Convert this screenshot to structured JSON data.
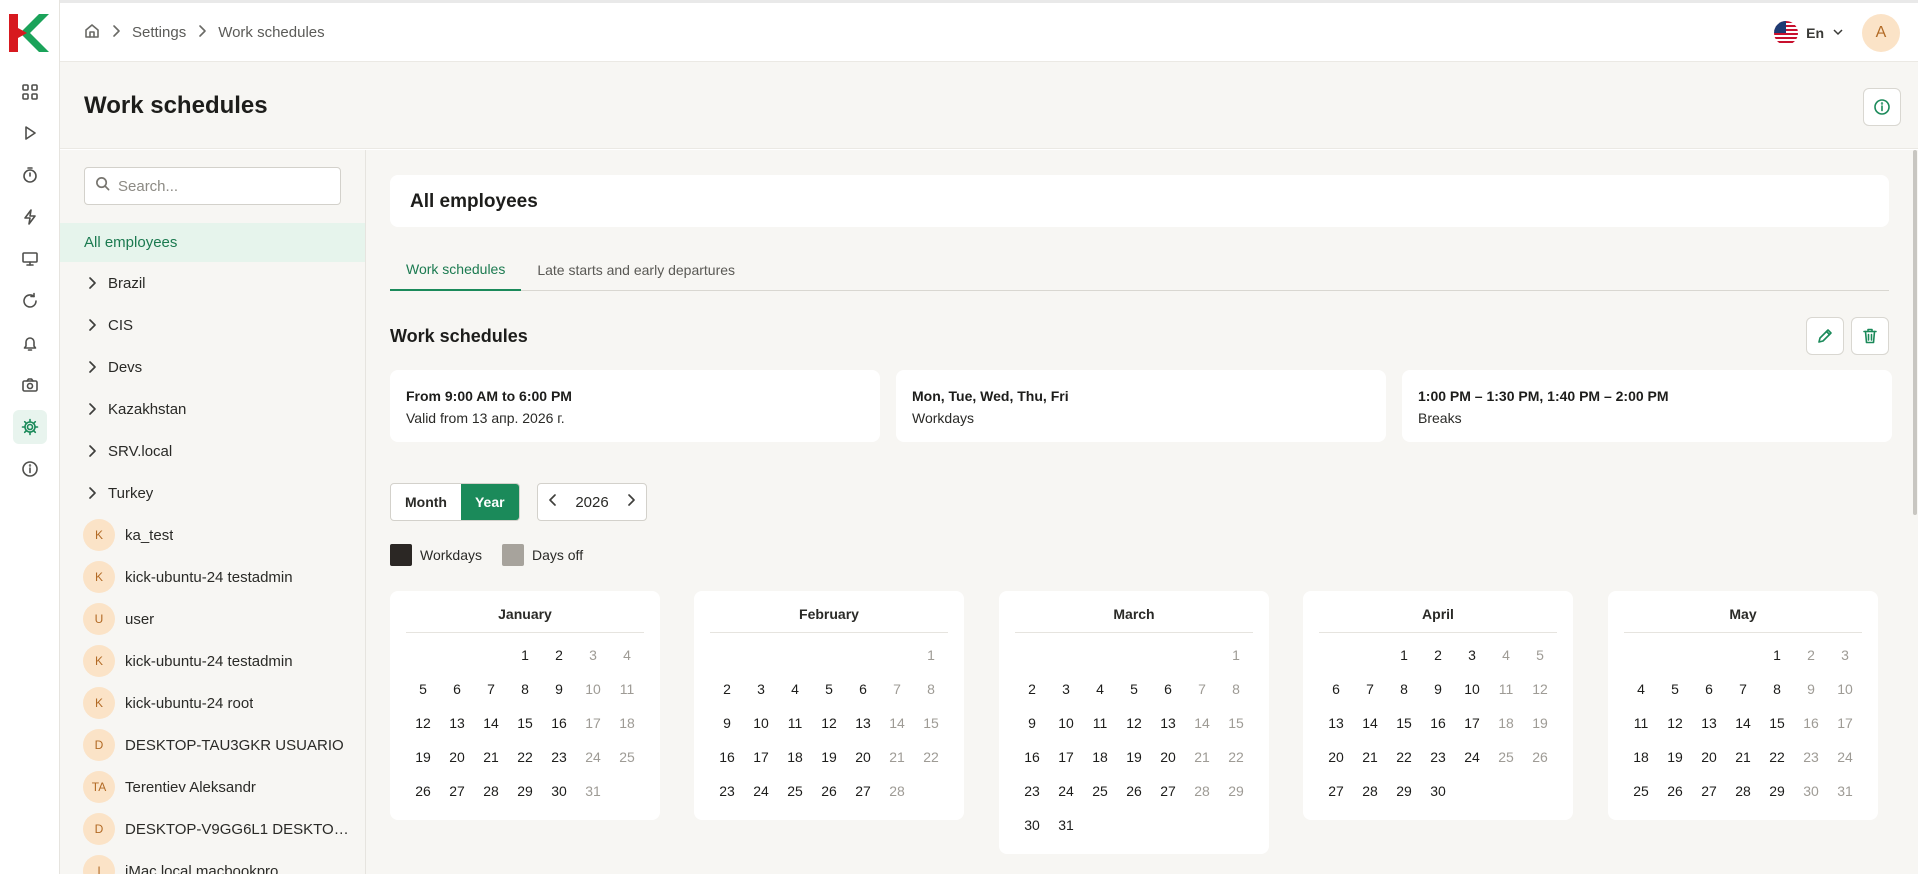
{
  "breadcrumbs": [
    "Settings",
    "Work schedules"
  ],
  "header": {
    "language": "En",
    "avatar_initial": "A"
  },
  "page": {
    "title": "Work schedules"
  },
  "search": {
    "placeholder": "Search..."
  },
  "tree": {
    "all_label": "All employees",
    "groups": [
      "Brazil",
      "CIS",
      "Devs",
      "Kazakhstan",
      "SRV.local",
      "Turkey"
    ],
    "users": [
      {
        "initials": "K",
        "name": "ka_test"
      },
      {
        "initials": "K",
        "name": "kick-ubuntu-24 testadmin"
      },
      {
        "initials": "U",
        "name": "user"
      },
      {
        "initials": "K",
        "name": "kick-ubuntu-24 testadmin"
      },
      {
        "initials": "K",
        "name": "kick-ubuntu-24 root"
      },
      {
        "initials": "D",
        "name": "DESKTOP-TAU3GKR USUARIO"
      },
      {
        "initials": "TA",
        "name": "Terentiev Aleksandr"
      },
      {
        "initials": "D",
        "name": "DESKTOP-V9GG6L1 DESKTOP-V9..."
      },
      {
        "initials": "I",
        "name": "iMac.local macbookpro"
      }
    ]
  },
  "main": {
    "group_title": "All employees",
    "tabs": [
      "Work schedules",
      "Late starts and early departures"
    ],
    "section_title": "Work schedules",
    "cards": [
      {
        "line1": "From 9:00 AM to 6:00 PM",
        "line2": "Valid from 13 апр. 2026 г."
      },
      {
        "line1": "Mon, Tue, Wed, Thu, Fri",
        "line2": "Workdays"
      },
      {
        "line1": "1:00 PM – 1:30 PM, 1:40 PM – 2:00 PM",
        "line2": "Breaks"
      }
    ],
    "view_toggle": {
      "month": "Month",
      "year": "Year",
      "selected": "Year"
    },
    "year": "2026",
    "legend": {
      "workdays": "Workdays",
      "days_off": "Days off"
    }
  },
  "colors": {
    "accent": "#1b8a5a",
    "workday_swatch": "#2b2724",
    "dayoff_swatch": "#a7a39c",
    "dayoff_text": "#9e9b95"
  },
  "calendar": [
    {
      "name": "January",
      "offset": 3,
      "days": 31
    },
    {
      "name": "February",
      "offset": 6,
      "days": 28
    },
    {
      "name": "March",
      "offset": 6,
      "days": 31
    },
    {
      "name": "April",
      "offset": 2,
      "days": 30
    },
    {
      "name": "May",
      "offset": 4,
      "days": 31
    }
  ]
}
